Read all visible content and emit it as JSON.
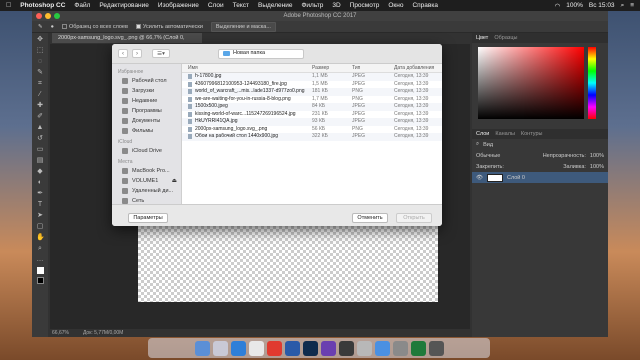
{
  "menubar": {
    "apple": "",
    "app": "Photoshop CC",
    "items": [
      "Файл",
      "Редактирование",
      "Изображение",
      "Слои",
      "Текст",
      "Выделение",
      "Фильтр",
      "3D",
      "Просмотр",
      "Окно",
      "Справка"
    ],
    "battery": "100%",
    "clock": "Вс 15:03"
  },
  "ps": {
    "title": "Adobe Photoshop CC 2017",
    "options": {
      "sample_all": "Образец со всех слоев",
      "auto_enhance": "Усилить автоматически",
      "select_mask": "Выделение и маска..."
    },
    "doc_tab": "2000px-samsung_logo.svg_.png @ 66,7% (Слой 0, RGB/8#)",
    "status": {
      "zoom": "66,67%",
      "doc": "Док: 5,77M/0,00M"
    },
    "panels": {
      "color_tabs": [
        "Цвет",
        "Образцы"
      ],
      "layer_tabs": [
        "Слои",
        "Каналы",
        "Контуры"
      ],
      "kind": "Вид",
      "blend": "Обычные",
      "opacity_label": "Непрозрачность:",
      "opacity": "100%",
      "lock_label": "Закрепить:",
      "fill_label": "Заливка:",
      "fill": "100%",
      "layer_name": "Слой 0"
    }
  },
  "dialog": {
    "folder": "Новая папка",
    "sidebar": {
      "favorites_head": "Избранное",
      "favorites": [
        "Рабочий стол",
        "Загрузки",
        "Недавние",
        "Программы",
        "Документы",
        "Фильмы"
      ],
      "icloud_head": "iCloud",
      "icloud": [
        "iCloud Drive"
      ],
      "places_head": "Места",
      "places": [
        "MacBook Pro...",
        "VOLUME1",
        "Удаленный ди...",
        "Сеть"
      ]
    },
    "columns": {
      "name": "Имя",
      "size": "Размер",
      "type": "Тип",
      "date": "Дата добавления"
    },
    "files": [
      {
        "name": "h-17800.jpg",
        "size": "1,1 МБ",
        "type": "JPEG",
        "date": "Сегодня, 13:39"
      },
      {
        "name": "43607996812100953-124493180_fire.jpg",
        "size": "1,5 МБ",
        "type": "JPEG",
        "date": "Сегодня, 13:39"
      },
      {
        "name": "world_of_warcraft_...mis...lade1337-d977zo0.png",
        "size": "181 КБ",
        "type": "PNG",
        "date": "Сегодня, 13:39"
      },
      {
        "name": "we-are-waiting-for-you-in-russia-8-blog.png",
        "size": "1,7 МБ",
        "type": "PNG",
        "date": "Сегодня, 13:39"
      },
      {
        "name": "1500x500.jpeg",
        "size": "84 КБ",
        "type": "JPEG",
        "date": "Сегодня, 13:39"
      },
      {
        "name": "kissing-world-of-warc...115247269196524.jpg",
        "size": "231 КБ",
        "type": "JPEG",
        "date": "Сегодня, 13:39"
      },
      {
        "name": "HkUYRRI41QA.jpg",
        "size": "93 КБ",
        "type": "JPEG",
        "date": "Сегодня, 13:39"
      },
      {
        "name": "2000px-samsung_logo.svg_.png",
        "size": "56 КБ",
        "type": "PNG",
        "date": "Сегодня, 13:39"
      },
      {
        "name": "Обои на рабочий стол 1440x900.jpg",
        "size": "322 КБ",
        "type": "JPEG",
        "date": "Сегодня, 13:39"
      }
    ],
    "buttons": {
      "options": "Параметры",
      "cancel": "Отменить",
      "open": "Открыть"
    }
  },
  "colors": {
    "accent": "#3e5a7c",
    "ps_bg": "#323232"
  }
}
